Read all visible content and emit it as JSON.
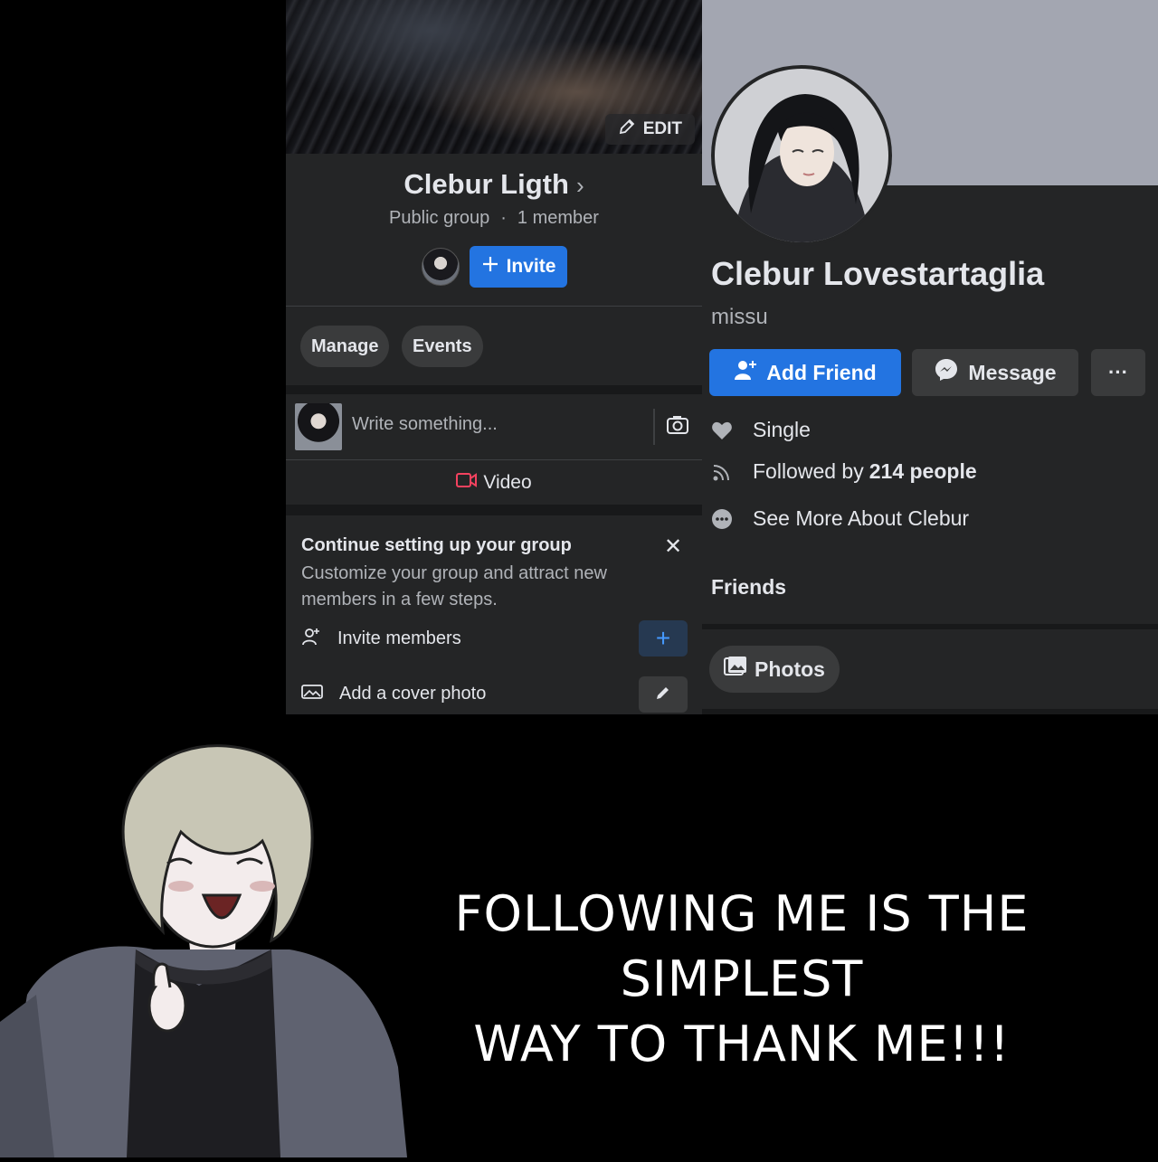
{
  "group": {
    "edit_cover_label": "EDIT",
    "name": "Clebur Ligth",
    "privacy": "Public group",
    "members": "1 member",
    "invite_label": "Invite",
    "tabs": [
      "Manage",
      "Events"
    ],
    "composer_placeholder": "Write something...",
    "video_label": "Video",
    "setup": {
      "title": "Continue setting up your group",
      "close": "✕",
      "description": "Customize your group and attract new members in a few steps.",
      "tasks": [
        "Invite members",
        "Add a cover photo"
      ]
    }
  },
  "profile": {
    "name": "Clebur Lovestartaglia",
    "nickname": "missu",
    "add_friend_label": "Add Friend",
    "message_label": "Message",
    "more_label": "···",
    "relationship": "Single",
    "followers_prefix": "Followed by",
    "followers_count": "214 people",
    "see_more": "See More About Clebur",
    "friends_heading": "Friends",
    "photos_tab": "Photos"
  },
  "caption": {
    "line1": "FOLLOWING ME IS THE SIMPLEST",
    "line2": "WAY TO THANK ME!!!"
  },
  "colors": {
    "accent_blue": "#2374e1",
    "panel_bg": "#242526",
    "button_bg": "#3a3b3c",
    "cover_gray": "#a3a6b1"
  }
}
